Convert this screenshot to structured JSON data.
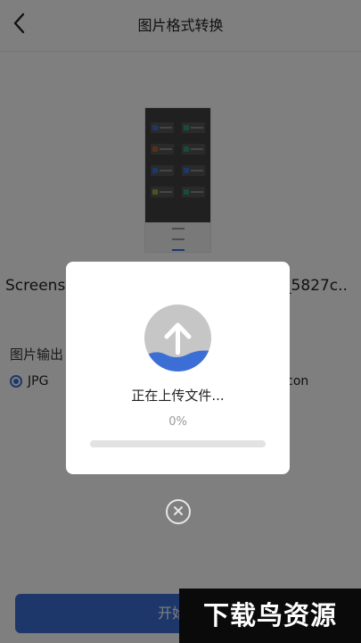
{
  "header": {
    "title": "图片格式转换",
    "back_icon": "chevron-left-icon"
  },
  "file": {
    "name_start": "Screens",
    "name_end": "_5827c.."
  },
  "format": {
    "section_label": "图片输出",
    "options": [
      {
        "label": "JPG",
        "selected": true
      },
      {
        "label": "Icon",
        "selected": false
      }
    ]
  },
  "bottom": {
    "start_label": "开始"
  },
  "dialog": {
    "icon": "upload-arrow-icon",
    "status": "正在上传文件...",
    "percent_label": "0%",
    "progress": 0
  },
  "close_icon": "close-circle-icon",
  "watermark": "下载鸟资源",
  "colors": {
    "accent": "#3b6fd6",
    "overlay": "rgba(0,0,0,0.5)",
    "wave": "#3b6fd6"
  }
}
